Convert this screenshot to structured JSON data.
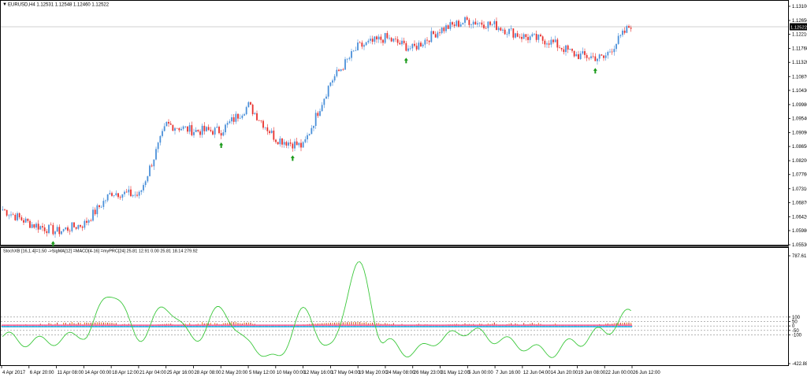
{
  "main_chart": {
    "title": "EURUSD,H4  1.12531 1.12548 1.12460 1.12522",
    "price_tag": "1.12522",
    "bull_color": "#4a90d9",
    "bear_color": "#e8302c",
    "signal_color": "#1a9a1a",
    "axis_labels": [
      "1.13100",
      "1.12650",
      "1.12210",
      "1.11760",
      "1.11320",
      "1.10870",
      "1.10430",
      "1.09980",
      "1.09540",
      "1.09090",
      "1.08650",
      "1.08200",
      "1.07760",
      "1.07310",
      "1.06870",
      "1.06420",
      "1.05980",
      "1.05530"
    ]
  },
  "indicator": {
    "title": "StochXB [16,1.4]=1.50 ->SigMA[12] =MACD[4-16] =myPRC[24] 25.81 12.91 0.00 25.81 18.14 279.92",
    "axis_labels": [
      "787.61",
      "100",
      "50",
      "0",
      "-50",
      "-100",
      "-422.88"
    ],
    "line_color": "#3cc83c",
    "histogram_colors": [
      "#ff6699",
      "#33b5e5",
      "#c0392b",
      "#e67e22"
    ]
  },
  "time_axis": [
    "4 Apr 2017",
    "6 Apr 20:00",
    "11 Apr 08:00",
    "14 Apr 00:00",
    "18 Apr 12:00",
    "21 Apr 04:00",
    "25 Apr 16:00",
    "28 Apr 08:00",
    "2 May 20:00",
    "5 May 12:00",
    "10 May 00:00",
    "12 May 16:00",
    "17 May 04:00",
    "19 May 20:00",
    "24 May 08:00",
    "26 May 23:00",
    "31 May 12:00",
    "5 Jun 00:00",
    "7 Jun 16:00",
    "12 Jun 04:00",
    "14 Jun 20:00",
    "19 Jun 08:00",
    "22 Jun 00:00",
    "26 Jun 12:00"
  ],
  "chart_data": {
    "type": "line",
    "title": "EURUSD,H4",
    "series": [
      {
        "name": "EURUSD",
        "x": [
          "4 Apr 2017",
          "6 Apr 20:00",
          "11 Apr 08:00",
          "14 Apr 00:00",
          "18 Apr 12:00",
          "21 Apr 04:00",
          "25 Apr 16:00",
          "28 Apr 08:00",
          "2 May 20:00",
          "5 May 12:00",
          "10 May 00:00",
          "12 May 16:00",
          "17 May 04:00",
          "19 May 20:00",
          "24 May 08:00",
          "26 May 23:00",
          "31 May 12:00",
          "5 Jun 00:00",
          "7 Jun 16:00",
          "12 Jun 04:00",
          "14 Jun 20:00",
          "19 Jun 08:00",
          "22 Jun 00:00",
          "26 Jun 12:00"
        ],
        "values": [
          1.0665,
          1.062,
          1.0595,
          1.062,
          1.072,
          1.071,
          1.0935,
          1.0915,
          1.0915,
          1.0995,
          1.089,
          1.0865,
          1.107,
          1.118,
          1.121,
          1.1175,
          1.1235,
          1.1265,
          1.125,
          1.1215,
          1.12,
          1.1155,
          1.1145,
          1.1252
        ]
      }
    ],
    "ylim": [
      1.0553,
      1.131
    ],
    "indicator": {
      "name": "StochXB",
      "x": [
        "4 Apr 2017",
        "6 Apr 20:00",
        "11 Apr 08:00",
        "14 Apr 00:00",
        "18 Apr 12:00",
        "21 Apr 04:00",
        "25 Apr 16:00",
        "28 Apr 08:00",
        "2 May 20:00",
        "5 May 12:00",
        "10 May 00:00",
        "12 May 16:00",
        "17 May 04:00",
        "19 May 20:00",
        "24 May 08:00",
        "26 May 23:00",
        "31 May 12:00",
        "5 Jun 00:00",
        "7 Jun 16:00",
        "12 Jun 04:00",
        "14 Jun 20:00",
        "19 Jun 08:00",
        "22 Jun 00:00",
        "26 Jun 12:00"
      ],
      "values": [
        -120,
        -180,
        -160,
        -90,
        380,
        -120,
        210,
        -140,
        180,
        -200,
        -380,
        150,
        -250,
        680,
        -190,
        -300,
        -150,
        -50,
        -140,
        -220,
        -300,
        -180,
        -60,
        140
      ],
      "ylim": [
        -422.88,
        787.61
      ],
      "levels": [
        100,
        50,
        0,
        -50,
        -100
      ]
    }
  }
}
